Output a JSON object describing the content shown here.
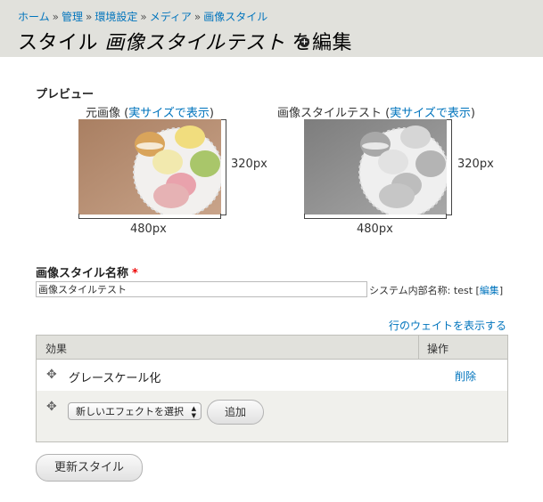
{
  "breadcrumb": {
    "items": [
      "ホーム",
      "管理",
      "環境設定",
      "メディア",
      "画像スタイル"
    ],
    "separator": "»"
  },
  "title": {
    "prefix": "スタイル",
    "style_name": "画像スタイルテスト",
    "suffix": "を編集"
  },
  "preview": {
    "label": "プレビュー",
    "original": {
      "caption": "元画像",
      "link": "実サイズで表示",
      "width_label": "480px",
      "height_label": "320px"
    },
    "derived": {
      "caption": "画像スタイルテスト",
      "link": "実サイズで表示",
      "width_label": "480px",
      "height_label": "320px"
    }
  },
  "form": {
    "name_label": "画像スタイル名称",
    "required_mark": "*",
    "name_value": "画像スタイルテスト",
    "machine_name_label": "システム内部名称:",
    "machine_name_value": "test",
    "machine_name_edit": "編集"
  },
  "weights_link": "行のウェイトを表示する",
  "effects_table": {
    "header_effect": "効果",
    "header_operations": "操作",
    "rows": [
      {
        "name": "グレースケール化",
        "operation": "削除"
      }
    ],
    "new_effect_select": "新しいエフェクトを選択",
    "add_button": "追加"
  },
  "update_button": "更新スタイル",
  "colors": {
    "header_bg": "#e1e1dc",
    "link": "#0074bd",
    "required": "#ee0000"
  },
  "icons": {
    "add_shortcut": "plus-circle-icon",
    "drag_handle": "move-arrows-icon",
    "select_arrows": "up-down-arrows-icon"
  }
}
